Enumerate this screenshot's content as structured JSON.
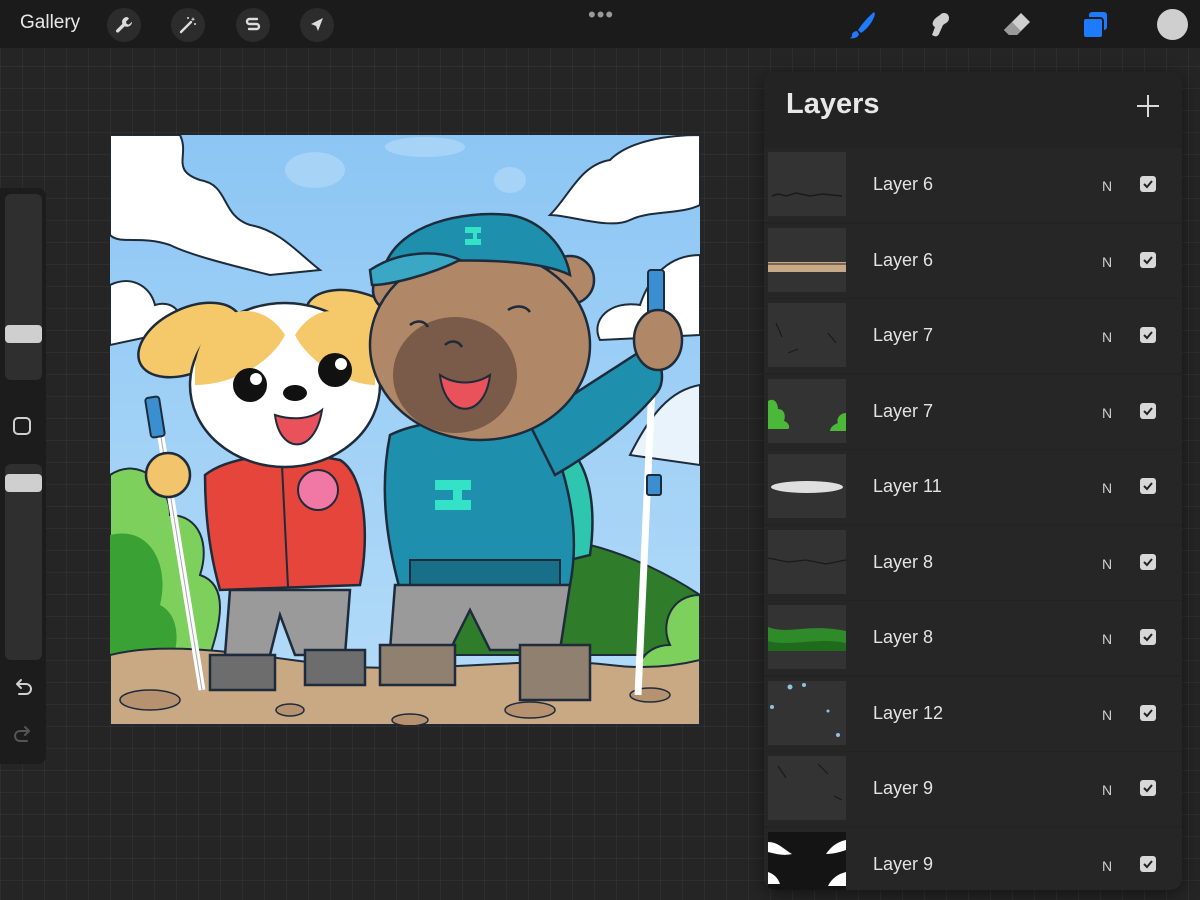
{
  "toolbar": {
    "gallery_label": "Gallery",
    "left_tools": [
      "wrench-icon",
      "magic-wand-icon",
      "selection-icon",
      "transform-arrow-icon"
    ],
    "more": "•••",
    "right_tools": [
      "brush-icon",
      "smudge-icon",
      "eraser-icon",
      "layers-icon"
    ],
    "active_tool": "layers-icon",
    "accent_color": "#1e7bff",
    "current_color": "#cfcfcf"
  },
  "sidebar": {
    "controls": [
      "brush-size-slider",
      "modify-button",
      "opacity-slider",
      "undo-icon",
      "redo-icon"
    ]
  },
  "layers_panel": {
    "title": "Layers",
    "add_icon": "plus-icon",
    "layers": [
      {
        "name": "Layer 6",
        "blend": "N",
        "visible": true,
        "thumb": "dark-specks"
      },
      {
        "name": "Layer 6",
        "blend": "N",
        "visible": true,
        "thumb": "ground-strip"
      },
      {
        "name": "Layer 7",
        "blend": "N",
        "visible": true,
        "thumb": "dark-lines"
      },
      {
        "name": "Layer 7",
        "blend": "N",
        "visible": true,
        "thumb": "green-bushes"
      },
      {
        "name": "Layer 11",
        "blend": "N",
        "visible": true,
        "thumb": "white-blur"
      },
      {
        "name": "Layer 8",
        "blend": "N",
        "visible": true,
        "thumb": "dark-lines"
      },
      {
        "name": "Layer 8",
        "blend": "N",
        "visible": true,
        "thumb": "green-hills"
      },
      {
        "name": "Layer 12",
        "blend": "N",
        "visible": true,
        "thumb": "blue-dots"
      },
      {
        "name": "Layer 9",
        "blend": "N",
        "visible": true,
        "thumb": "dark-lines"
      },
      {
        "name": "Layer 9",
        "blend": "N",
        "visible": true,
        "thumb": "white-clouds"
      }
    ]
  },
  "canvas": {
    "description_colors": {
      "sky": "#8fc9f5",
      "dog_jacket": "#e5453a",
      "bear_hoodie": "#1f8fae",
      "bear_fur": "#b08868",
      "ground": "#c8a987"
    }
  }
}
